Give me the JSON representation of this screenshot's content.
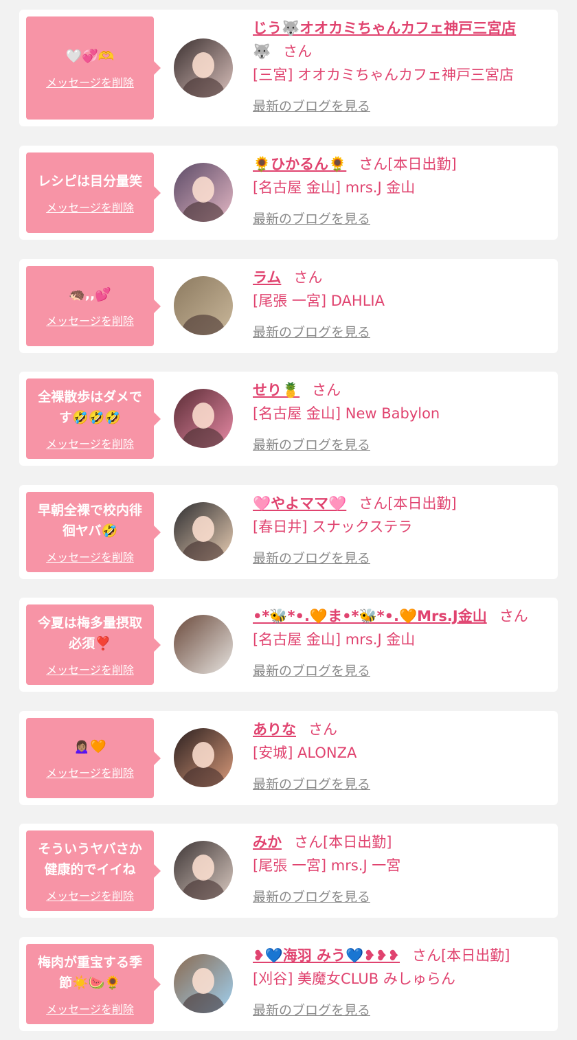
{
  "items": [
    {
      "message": "🤍💞🫶",
      "delete_label": "メッセージを削除",
      "name": "じう🐺オオカミちゃんカフェ神戸三宮店",
      "name_suffix": "🐺",
      "honorific": "さん",
      "shop": "[三宮] オオカミちゃんカフェ神戸三宮店",
      "blog_label": "最新のブログを見る",
      "avatar_colors": [
        "#3b3030",
        "#d9c0bb"
      ]
    },
    {
      "message": "レシピは目分量笑",
      "delete_label": "メッセージを削除",
      "name": "🌻ひかるん🌻",
      "honorific": "さん[本日出勤]",
      "shop": "[名古屋 金山] mrs.J 金山",
      "blog_label": "最新のブログを見る",
      "avatar_colors": [
        "#5b4a66",
        "#e3b7c4"
      ]
    },
    {
      "message": "🦔,,💕",
      "delete_label": "メッセージを削除",
      "name": "ラム",
      "honorific": "さん",
      "shop": "[尾張 一宮] DAHLIA",
      "blog_label": "最新のブログを見る",
      "avatar_colors": [
        "#8c7a60",
        "#c9b79a"
      ]
    },
    {
      "message": "全裸散歩はダメです🤣🤣🤣",
      "delete_label": "メッセージを削除",
      "name": "せり🍍",
      "honorific": "さん",
      "shop": "[名古屋 金山] New Babylon",
      "blog_label": "最新のブログを見る",
      "avatar_colors": [
        "#5a2c35",
        "#e78aa5"
      ]
    },
    {
      "message": "早朝全裸で校内徘徊ヤバ🤣",
      "delete_label": "メッセージを削除",
      "name": "🩷やよママ🩷",
      "honorific": "さん[本日出勤]",
      "shop": "[春日井] スナックステラ",
      "blog_label": "最新のブログを見る",
      "avatar_colors": [
        "#2d2d30",
        "#e8cdb3"
      ]
    },
    {
      "message": "今夏は梅多量摂取必須❣️",
      "delete_label": "メッセージを削除",
      "name": "•*🐝*•.🧡ま•*🐝*•.🧡Mrs.J金山",
      "honorific": "さん",
      "shop": "[名古屋 金山] mrs.J 金山",
      "blog_label": "最新のブログを見る",
      "avatar_colors": [
        "#6b4a3c",
        "#e6e3df"
      ]
    },
    {
      "message": "🙍🏽‍♀️🧡",
      "delete_label": "メッセージを削除",
      "name": "ありな",
      "honorific": "さん",
      "shop": "[安城] ALONZA",
      "blog_label": "最新のブログを見る",
      "avatar_colors": [
        "#2a1f1f",
        "#d99a7a"
      ]
    },
    {
      "message": "そういうヤバさか健康的でイイね",
      "delete_label": "メッセージを削除",
      "name": "みか",
      "honorific": "さん[本日出勤]",
      "shop": "[尾張 一宮] mrs.J 一宮",
      "blog_label": "最新のブログを見る",
      "avatar_colors": [
        "#3d3535",
        "#d9c9c0"
      ]
    },
    {
      "message": "梅肉が重宝する季節☀️🍉🌻",
      "delete_label": "メッセージを削除",
      "name": "❥💙海羽 みう💙❥❥❥",
      "honorific": "さん[本日出勤]",
      "shop": "[刈谷] 美魔女CLUB みしゅらん",
      "blog_label": "最新のブログを見る",
      "avatar_colors": [
        "#8a6a50",
        "#9fd0f0"
      ]
    }
  ]
}
